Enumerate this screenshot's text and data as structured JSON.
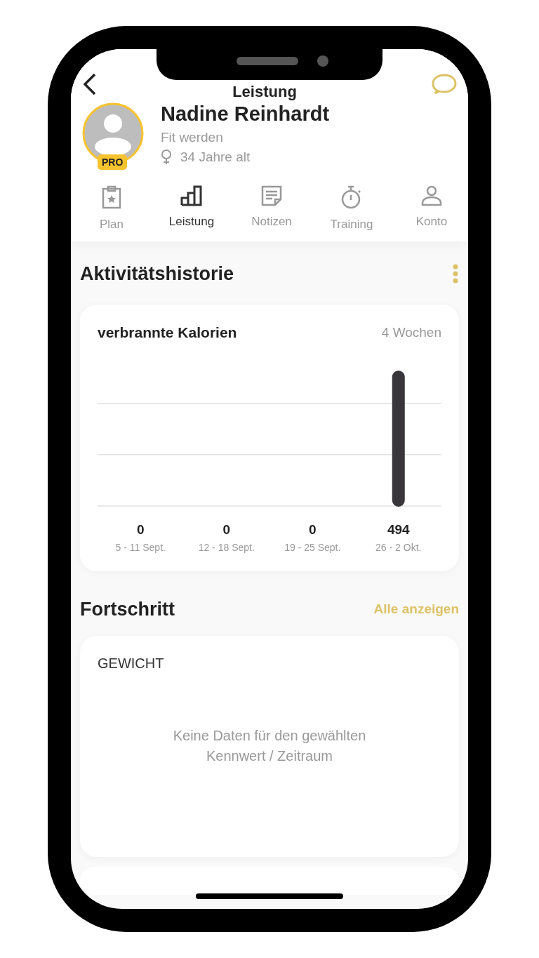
{
  "header": {
    "title": "Leistung"
  },
  "profile": {
    "name": "Nadine Reinhardt",
    "goal": "Fit werden",
    "age": "34 Jahre alt",
    "badge": "PRO"
  },
  "tabs": [
    {
      "label": "Plan",
      "selected": false
    },
    {
      "label": "Leistung",
      "selected": true
    },
    {
      "label": "Notizen",
      "selected": false
    },
    {
      "label": "Training",
      "selected": false
    },
    {
      "label": "Konto",
      "selected": false
    }
  ],
  "activity": {
    "title": "Aktivitätshistorie",
    "card": {
      "title": "verbrannte Kalorien",
      "period": "4 Wochen",
      "chart_data": {
        "type": "bar",
        "categories": [
          "5 - 11 Sept.",
          "12 - 18 Sept.",
          "19 - 25 Sept.",
          "26 - 2 Okt."
        ],
        "values": [
          0,
          0,
          0,
          494
        ],
        "data_labels": true
      }
    }
  },
  "progress": {
    "title": "Fortschritt",
    "link": "Alle anzeigen",
    "card": {
      "title": "GEWICHT",
      "empty": "Keine Daten für den gewählten Kennwert / Zeitraum"
    }
  }
}
